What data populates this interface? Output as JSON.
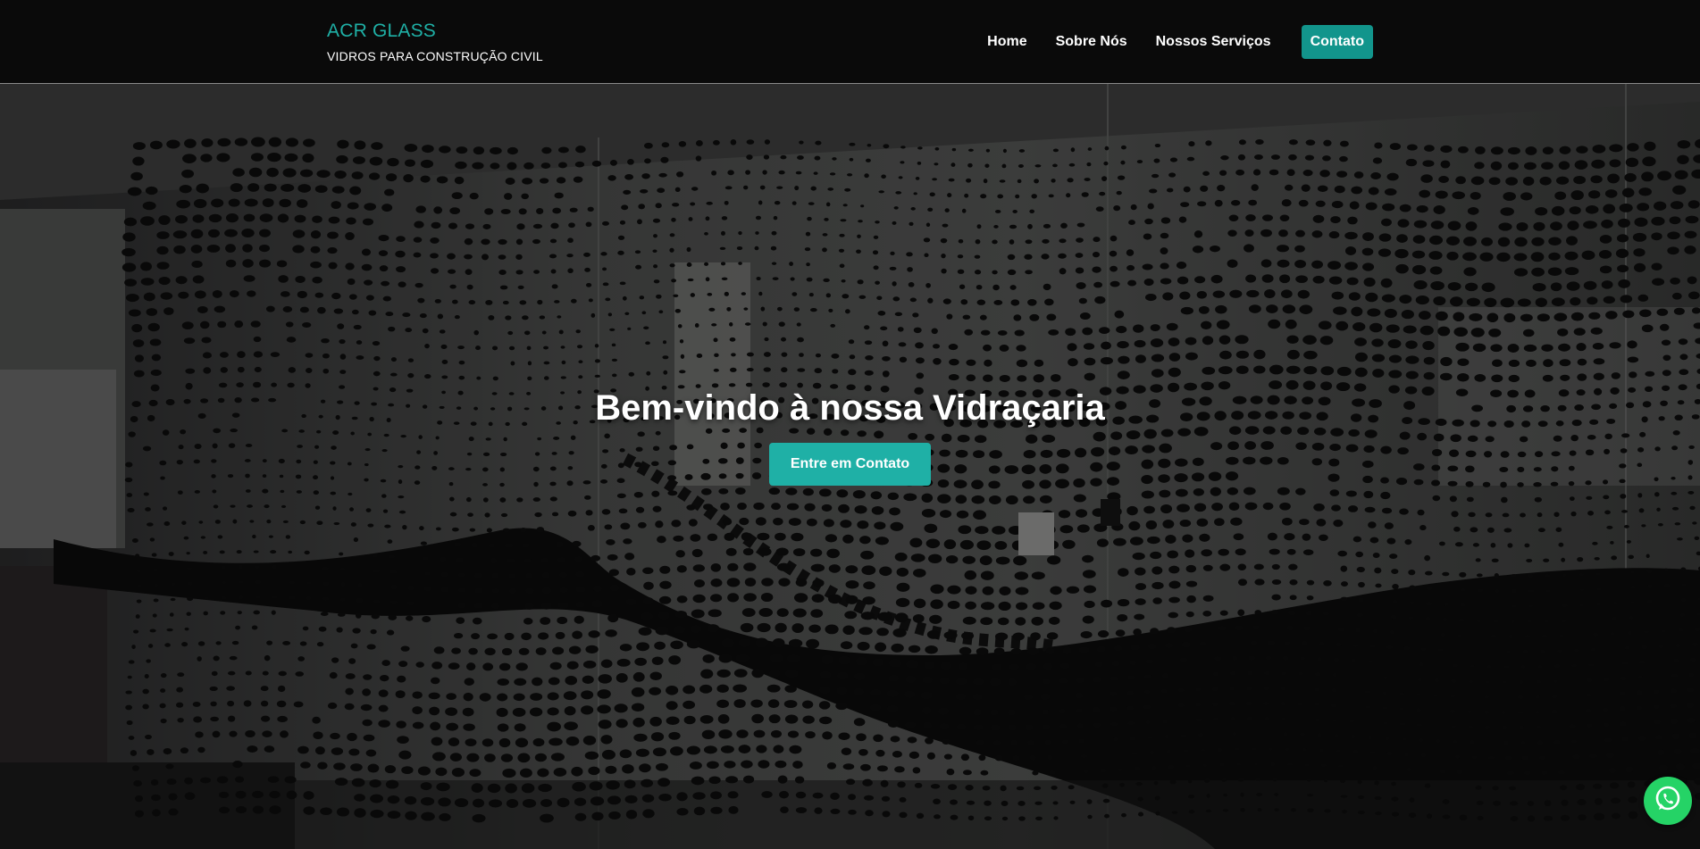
{
  "brand": {
    "name": "ACR GLASS",
    "tagline": "VIDROS PARA CONSTRUÇÃO CIVIL"
  },
  "nav": {
    "items": [
      {
        "label": "Home"
      },
      {
        "label": "Sobre Nós"
      },
      {
        "label": "Nossos Serviços"
      },
      {
        "label": "Contato",
        "active": true
      }
    ]
  },
  "hero": {
    "title": "Bem-vindo à nossa Vidraçaria",
    "button_label": "Entre em Contato"
  },
  "floating": {
    "icon": "whatsapp-icon"
  },
  "colors": {
    "accent": "#1fb0a6",
    "active_nav_bg": "#12958c",
    "header_bg": "#0a0a0a",
    "whatsapp": "#25d366"
  }
}
